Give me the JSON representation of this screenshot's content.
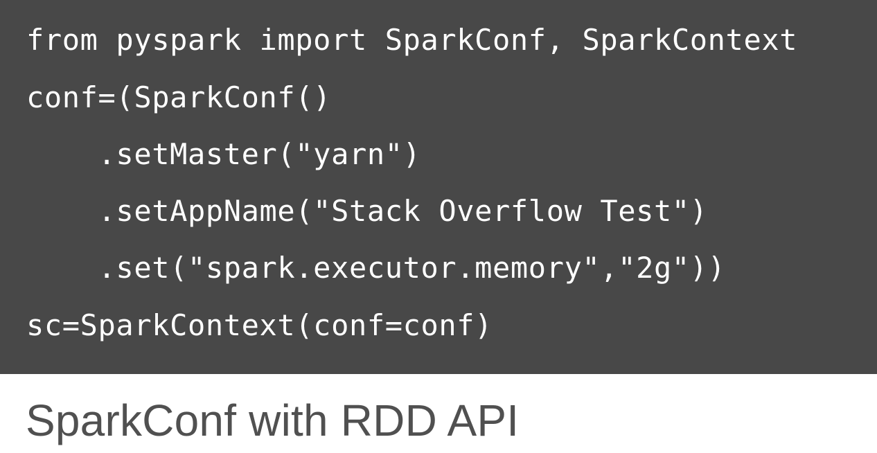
{
  "code_block": {
    "lines": [
      "from pyspark import SparkConf, SparkContext",
      "conf=(SparkConf()",
      "    .setMaster(\"yarn\")",
      "    .setAppName(\"Stack Overflow Test\")",
      "    .set(\"spark.executor.memory\",\"2g\"))",
      "sc=SparkContext(conf=conf)"
    ]
  },
  "caption": "SparkConf with RDD API",
  "colors": {
    "code_background": "#484848",
    "code_text": "#ffffff",
    "page_background": "#ffffff",
    "caption_text": "#505050"
  }
}
